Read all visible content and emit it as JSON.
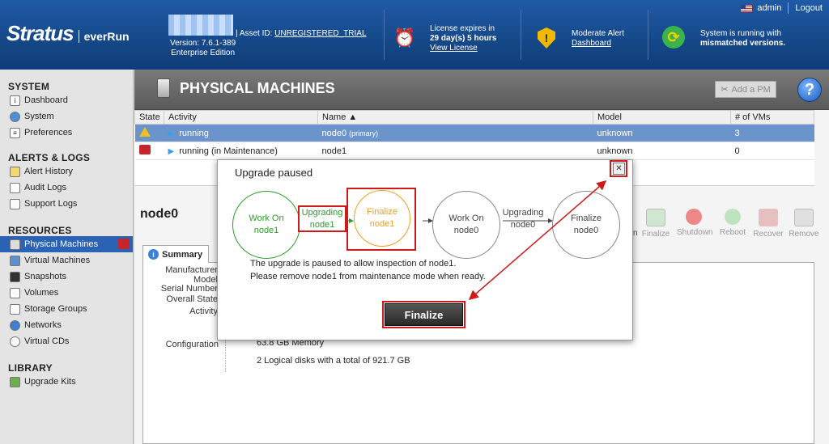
{
  "header": {
    "user": "admin",
    "logout": "Logout",
    "logo_main": "Stratus",
    "logo_sub": "everRun",
    "version": "Version: 7.6.1-389",
    "edition": "Enterprise Edition",
    "asset_label": "| Asset ID:",
    "asset_value": "UNREGISTERED_TRIAL",
    "license_line1": "License expires in",
    "license_line2": "29 day(s) 5 hours",
    "license_link": "View License",
    "alert_line1": "Moderate Alert",
    "alert_link": "Dashboard",
    "status_line1": "System is running with",
    "status_line2": "mismatched versions."
  },
  "sidebar": {
    "system": "SYSTEM",
    "system_items": [
      "Dashboard",
      "System",
      "Preferences"
    ],
    "alerts": "ALERTS & LOGS",
    "alerts_items": [
      "Alert History",
      "Audit Logs",
      "Support Logs"
    ],
    "resources": "RESOURCES",
    "resources_items": [
      "Physical Machines",
      "Virtual Machines",
      "Snapshots",
      "Volumes",
      "Storage Groups",
      "Networks",
      "Virtual CDs"
    ],
    "library": "LIBRARY",
    "library_items": [
      "Upgrade Kits"
    ]
  },
  "main": {
    "title": "PHYSICAL MACHINES",
    "add_pm": "Add a PM",
    "help": "?",
    "columns": [
      "State",
      "Activity",
      "Name ▲",
      "Model",
      "# of VMs"
    ],
    "rows": [
      {
        "activity": "running",
        "name": "node0",
        "name_tag": "(primary)",
        "model": "unknown",
        "vms": "3"
      },
      {
        "activity": "running (in Maintenance)",
        "name": "node1",
        "name_tag": "",
        "model": "unknown",
        "vms": "0"
      }
    ],
    "node_title": "node0",
    "actions": [
      "Finalize",
      "Shutdown",
      "Reboot",
      "Recover",
      "Remove"
    ],
    "tab_summary": "Summary",
    "labels": [
      "Manufacturer",
      "Model",
      "Serial Number",
      "Overall State",
      "Activity"
    ],
    "config_label": "Configuration",
    "config_lines": [
      "63.8 GB Memory",
      "2 Logical disks with a total of 921.7 GB"
    ]
  },
  "dialog": {
    "title": "Upgrade paused",
    "close": "✕",
    "step1": [
      "Work On",
      "node1"
    ],
    "link1": [
      "Upgrading",
      "node1"
    ],
    "step2": [
      "Finalize",
      "node1"
    ],
    "step3": [
      "Work On",
      "node0"
    ],
    "link2": [
      "Upgrading",
      "node0"
    ],
    "step4": [
      "Finalize",
      "node0"
    ],
    "message1": "The upgrade is paused to allow inspection of node1.",
    "message2": "Please remove node1 from maintenance mode when ready.",
    "finalize_button": "Finalize"
  },
  "colors": {
    "header": "#1a52a0",
    "selected": "#2a63b5",
    "green": "#2a9d2a",
    "orange": "#f0a020",
    "annotation": "#d01a1a"
  }
}
